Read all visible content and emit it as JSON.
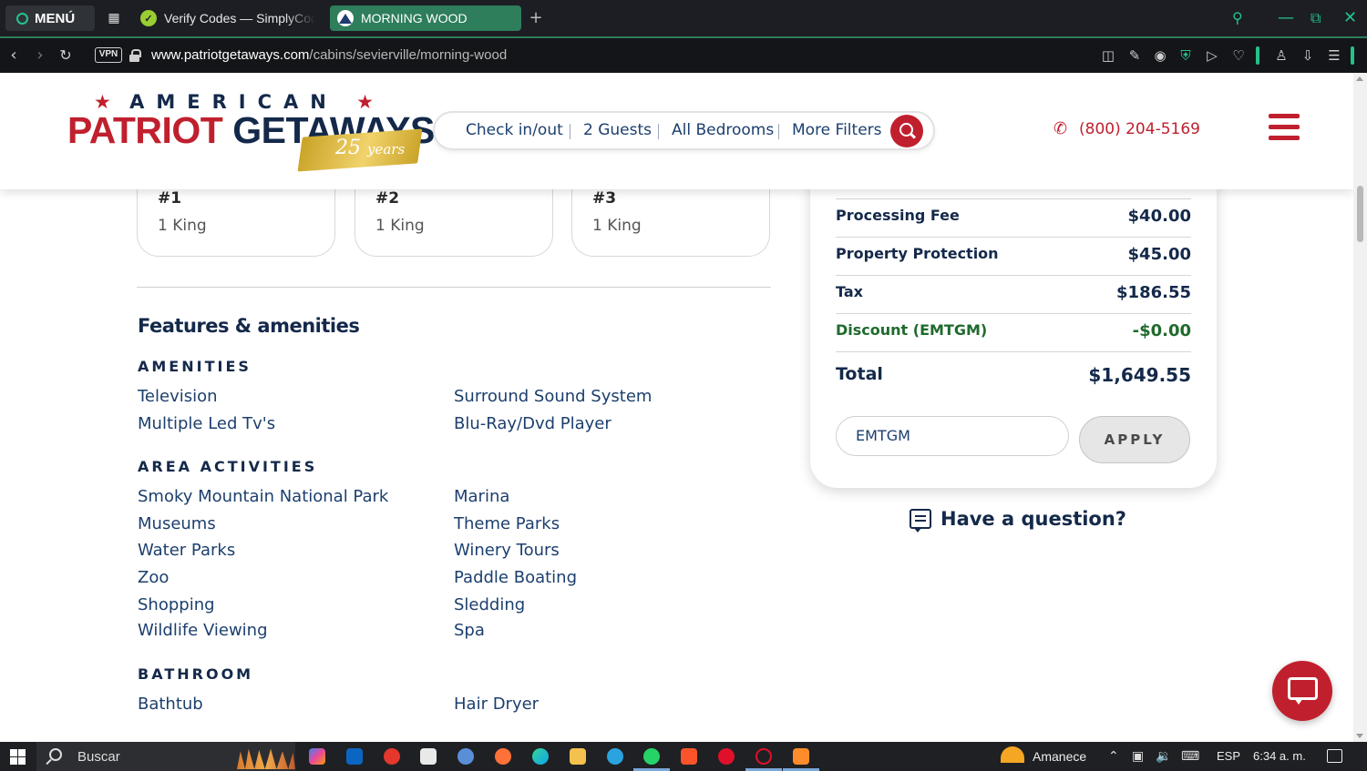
{
  "browser": {
    "menu_label": "MENÚ",
    "tabs": [
      {
        "title": "Verify Codes — SimplyCodes",
        "active": false
      },
      {
        "title": "MORNING WOOD",
        "active": true
      }
    ],
    "new_tab_glyph": "+",
    "url_host": "www.patriotgetaways.com",
    "url_path": "/cabins/sevierville/morning-wood",
    "vpn_label": "VPN",
    "accent_color": "#25c28a",
    "active_tab_color": "#2e7d5b"
  },
  "site": {
    "logo": {
      "top_text": "AMERICAN",
      "brand_red": "PATRIOT",
      "brand_navy": "GETAWAYS",
      "anniversary_number": "25",
      "anniversary_word": "years"
    },
    "search": {
      "check_label": "Check in/out",
      "guests_label": "2 Guests",
      "bedrooms_label": "All Bedrooms",
      "filters_label": "More Filters"
    },
    "phone": "(800) 204-5169",
    "colors": {
      "brand_red": "#c0202e",
      "navy": "#14294a",
      "link_blue": "#1c3f6e",
      "discount_green": "#1f6a2c"
    }
  },
  "bedrooms": [
    {
      "number": "#1",
      "bed": "1 King"
    },
    {
      "number": "#2",
      "bed": "1 King"
    },
    {
      "number": "#3",
      "bed": "1 King"
    }
  ],
  "features": {
    "title": "Features & amenities",
    "amenities": {
      "heading": "AMENITIES",
      "left": [
        "Television",
        "Multiple Led Tv's"
      ],
      "right": [
        "Surround Sound System",
        "Blu-Ray/Dvd Player"
      ]
    },
    "area_activities": {
      "heading": "AREA ACTIVITIES",
      "left": [
        "Smoky Mountain National Park",
        "Museums",
        "Water Parks",
        "Zoo",
        "Shopping",
        "Wildlife Viewing"
      ],
      "right": [
        "Marina",
        "Theme Parks",
        "Winery Tours",
        "Paddle Boating",
        "Sledding",
        "Spa"
      ]
    },
    "bathroom": {
      "heading": "BATHROOM",
      "left": [
        "Bathtub"
      ],
      "right": [
        "Hair Dryer"
      ]
    }
  },
  "pricing": {
    "rows": [
      {
        "label": "Processing Fee",
        "value": "$40.00"
      },
      {
        "label": "Property Protection",
        "value": "$45.00"
      },
      {
        "label": "Tax",
        "value": "$186.55"
      },
      {
        "label": "Discount (EMTGM)",
        "value": "-$0.00"
      }
    ],
    "total_label": "Total",
    "total_value": "$1,649.55",
    "promo_code_value": "EMTGM",
    "apply_label": "APPLY"
  },
  "question_label": "Have a question?",
  "taskbar": {
    "search_label": "Buscar",
    "weather_label": "Amanece",
    "language": "ESP",
    "time": "6:34 a. m."
  }
}
